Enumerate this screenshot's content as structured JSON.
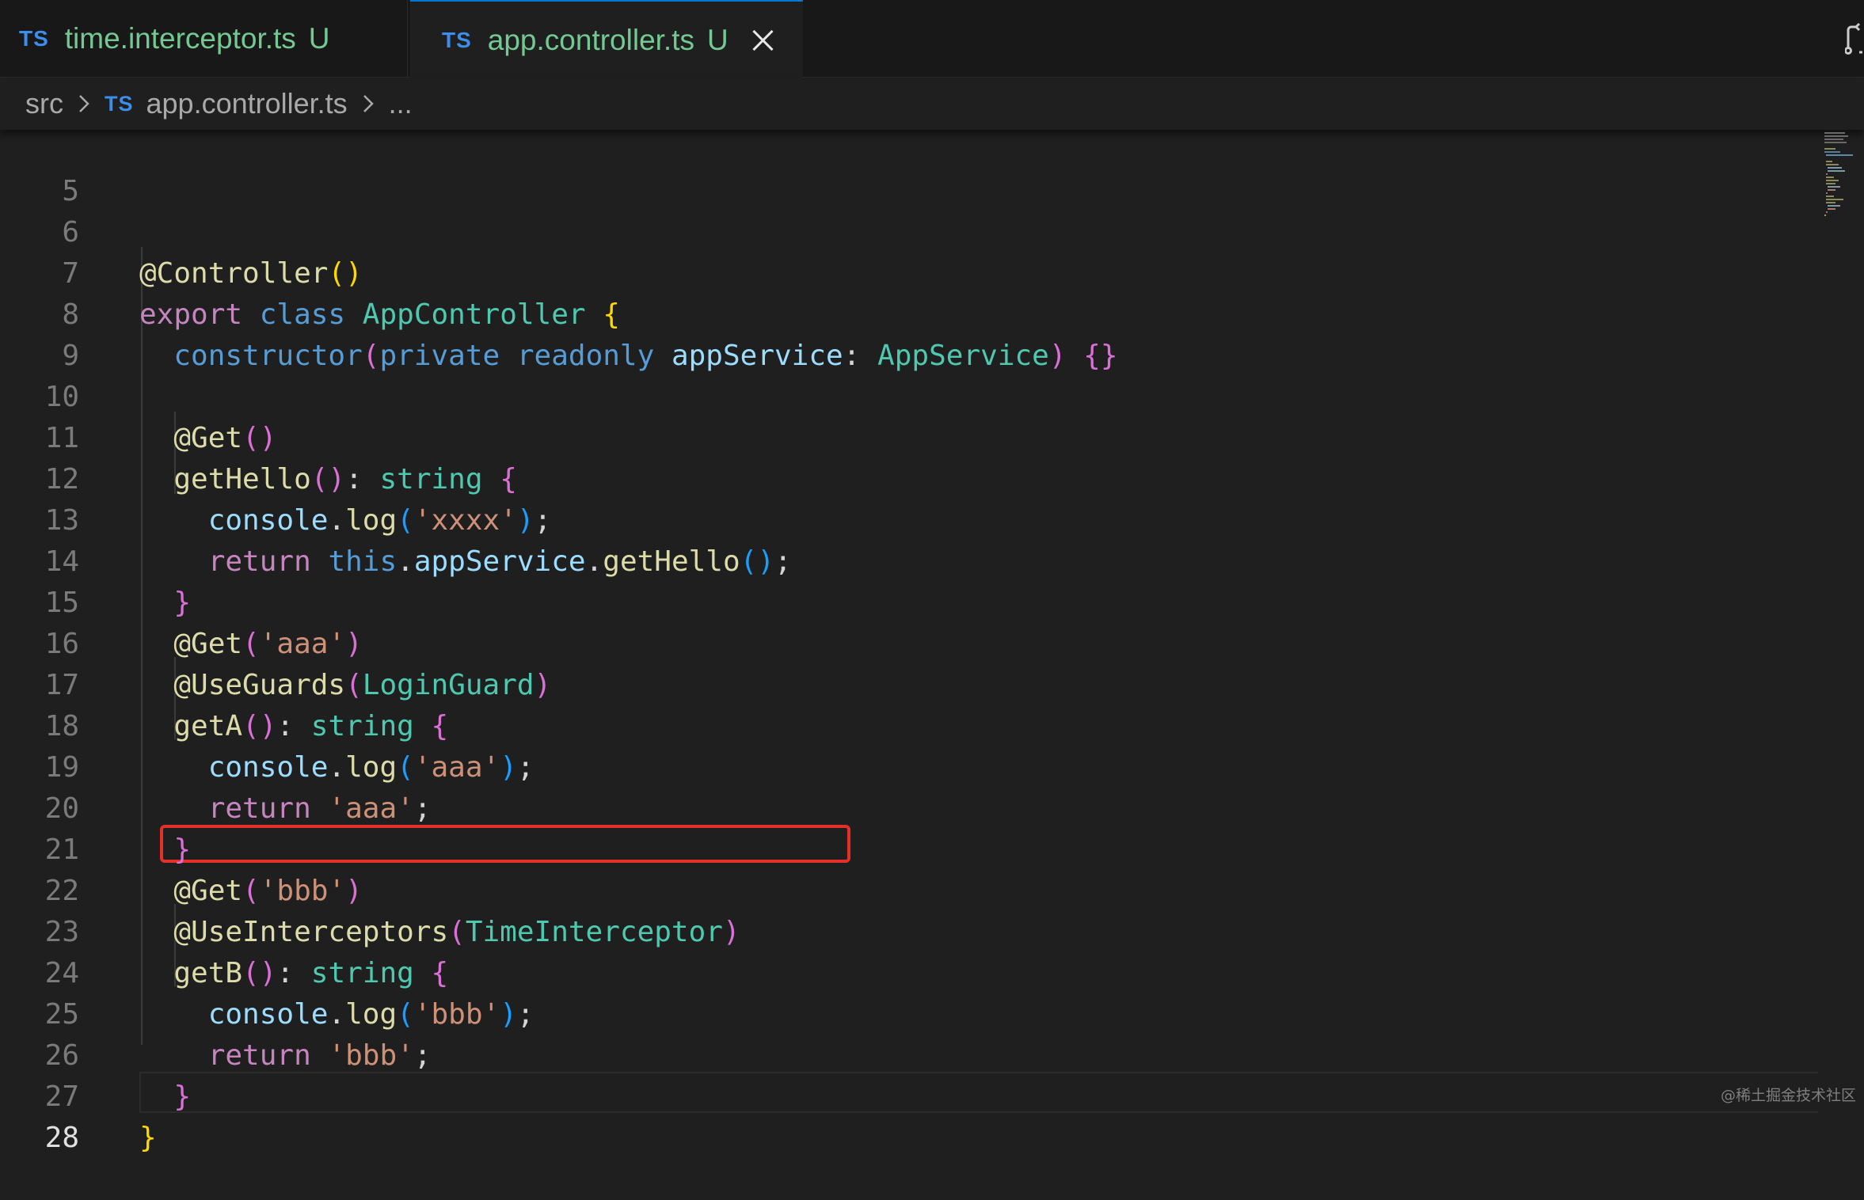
{
  "tabs": [
    {
      "lang_badge": "TS",
      "filename": "time.interceptor.ts",
      "status": "U",
      "active": false
    },
    {
      "lang_badge": "TS",
      "filename": "app.controller.ts",
      "status": "U",
      "active": true
    }
  ],
  "breadcrumb": {
    "folder": "src",
    "lang_badge": "TS",
    "file": "app.controller.ts",
    "symbol": "..."
  },
  "editor": {
    "active_line": "28",
    "highlighted_line": "22",
    "lines": [
      {
        "n": "5"
      },
      {
        "n": "6"
      },
      {
        "n": "7"
      },
      {
        "n": "8"
      },
      {
        "n": "9"
      },
      {
        "n": "10"
      },
      {
        "n": "11"
      },
      {
        "n": "12"
      },
      {
        "n": "13"
      },
      {
        "n": "14"
      },
      {
        "n": "15"
      },
      {
        "n": "16"
      },
      {
        "n": "17"
      },
      {
        "n": "18"
      },
      {
        "n": "19"
      },
      {
        "n": "20"
      },
      {
        "n": "21"
      },
      {
        "n": "22"
      },
      {
        "n": "23"
      },
      {
        "n": "24"
      },
      {
        "n": "25"
      },
      {
        "n": "26"
      },
      {
        "n": "27"
      },
      {
        "n": "28"
      }
    ]
  },
  "code": {
    "l6": {
      "decorator": "@Controller",
      "open": "(",
      "close": ")"
    },
    "l7": {
      "kw_export": "export",
      "kw_class": "class",
      "name": "AppController",
      "brace": "{"
    },
    "l8": {
      "ctor": "constructor",
      "open": "(",
      "kw_private": "private",
      "kw_readonly": "readonly",
      "param": "appService",
      "colon": ":",
      "type": "AppService",
      "close": ")",
      "body": "{}"
    },
    "l10": {
      "decorator": "@Get",
      "parens": "()"
    },
    "l11": {
      "method": "getHello",
      "parens": "()",
      "colon": ":",
      "type": "string",
      "brace": "{"
    },
    "l12": {
      "obj": "console",
      "dot": ".",
      "fn": "log",
      "open": "(",
      "str": "'xxxx'",
      "close": ")",
      "semi": ";"
    },
    "l13": {
      "kw": "return",
      "this": "this",
      "dot1": ".",
      "prop": "appService",
      "dot2": ".",
      "fn": "getHello",
      "parens": "()",
      "semi": ";"
    },
    "l14": {
      "brace": "}"
    },
    "l15": {
      "decorator": "@Get",
      "open": "(",
      "str": "'aaa'",
      "close": ")"
    },
    "l16": {
      "decorator": "@UseGuards",
      "open": "(",
      "arg": "LoginGuard",
      "close": ")"
    },
    "l17": {
      "method": "getA",
      "parens": "()",
      "colon": ":",
      "type": "string",
      "brace": "{"
    },
    "l18": {
      "obj": "console",
      "dot": ".",
      "fn": "log",
      "open": "(",
      "str": "'aaa'",
      "close": ")",
      "semi": ";"
    },
    "l19": {
      "kw": "return",
      "str": "'aaa'",
      "semi": ";"
    },
    "l20": {
      "brace": "}"
    },
    "l21": {
      "decorator": "@Get",
      "open": "(",
      "str": "'bbb'",
      "close": ")"
    },
    "l22": {
      "decorator": "@UseInterceptors",
      "open": "(",
      "arg": "TimeInterceptor",
      "close": ")"
    },
    "l23": {
      "method": "getB",
      "parens": "()",
      "colon": ":",
      "type": "string",
      "brace": "{"
    },
    "l24": {
      "obj": "console",
      "dot": ".",
      "fn": "log",
      "open": "(",
      "str": "'bbb'",
      "close": ")",
      "semi": ";"
    },
    "l25": {
      "kw": "return",
      "str": "'bbb'",
      "semi": ";"
    },
    "l26": {
      "brace": "}"
    },
    "l27": {
      "brace": "}"
    }
  },
  "watermark": "@稀土掘金技术社区",
  "colors": {
    "editor_bg": "#1f1f1f",
    "highlight_border": "#e5302a",
    "untracked_green": "#73c991",
    "ts_badge_blue": "#3b8eea"
  },
  "icons": {
    "close_tab": "close-icon",
    "breadcrumb_separator": "chevron-right-icon",
    "compare": "compare-changes-icon"
  }
}
